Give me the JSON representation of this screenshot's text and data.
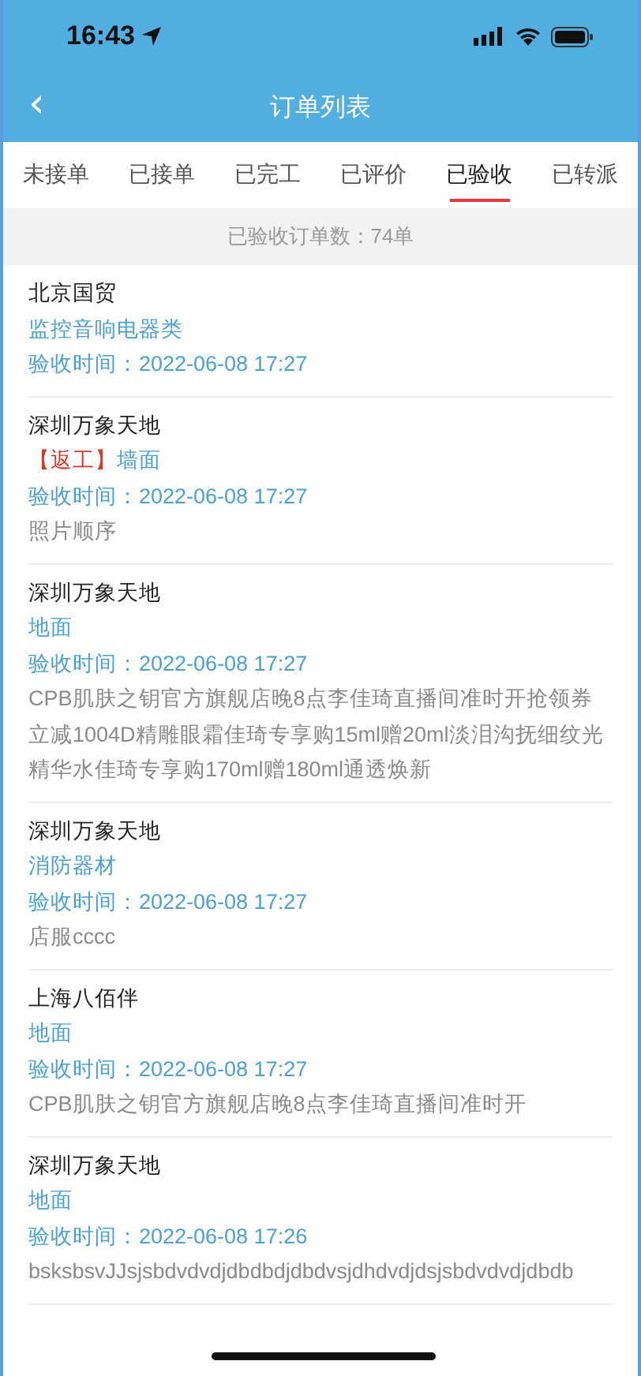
{
  "status_bar": {
    "time": "16:43"
  },
  "nav_bar": {
    "back": "‹",
    "title": "订单列表"
  },
  "tabs": [
    {
      "label": "未接单",
      "selected": false
    },
    {
      "label": "已接单",
      "selected": false
    },
    {
      "label": "已完工",
      "selected": false
    },
    {
      "label": "已评价",
      "selected": false
    },
    {
      "label": "已验收",
      "selected": true
    },
    {
      "label": "已转派",
      "selected": false
    }
  ],
  "summary": "已验收订单数：74单",
  "orders": [
    {
      "site": "北京国贸",
      "category": "监控音响电器类",
      "time": "验收时间：2022-06-08 17:27"
    },
    {
      "site": "深圳万象天地",
      "tag": "【返工】",
      "category": "墙面",
      "time": "验收时间：2022-06-08 17:27",
      "note": "照片顺序"
    },
    {
      "site": "深圳万象天地",
      "category": "地面",
      "time": "验收时间：2022-06-08 17:27",
      "note": "CPB肌肤之钥官方旗舰店晚8点李佳琦直播间准时开抢领券立减1004D精雕眼霜佳琦专享购15ml赠20ml淡泪沟抚细纹光精华水佳琦专享购170ml赠180ml通透焕新"
    },
    {
      "site": "深圳万象天地",
      "category": "消防器材",
      "time": "验收时间：2022-06-08 17:27",
      "note": "店服cccc"
    },
    {
      "site": "上海八佰伴",
      "category": "地面",
      "time": "验收时间：2022-06-08 17:27",
      "note": "CPB肌肤之钥官方旗舰店晚8点李佳琦直播间准时开"
    },
    {
      "site": "深圳万象天地",
      "category": "地面",
      "time": "验收时间：2022-06-08 17:26",
      "note": "bsksbsvJJsjsbdvdvdjdbdbdjdbdvsjdhdvdjdsjsbdvdvdjdbdb"
    }
  ]
}
